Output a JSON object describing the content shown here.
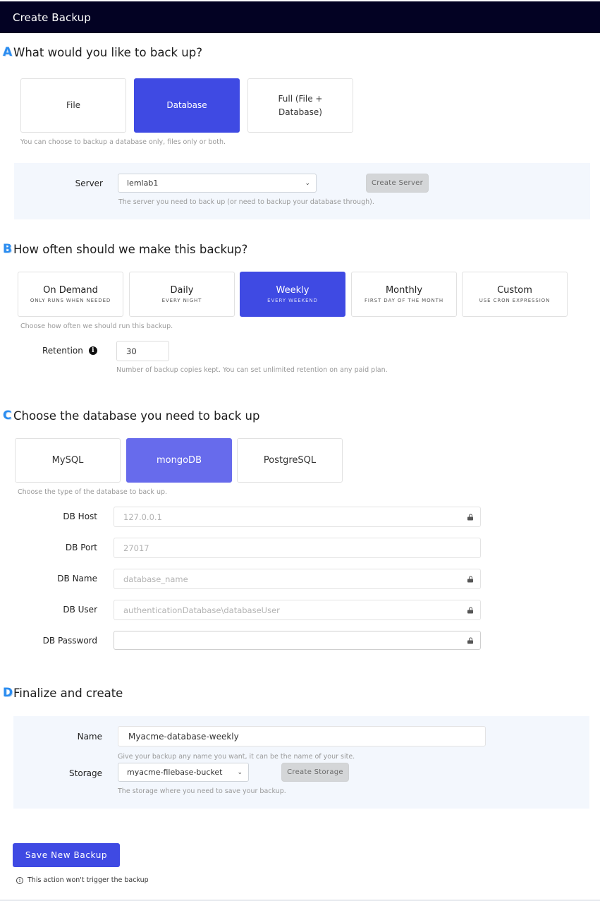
{
  "header": {
    "title": "Create Backup"
  },
  "section_a": {
    "badge": "A",
    "title": "What would you like to back up?",
    "options": [
      {
        "label": "File",
        "selected": false
      },
      {
        "label": "Database",
        "selected": true
      },
      {
        "label": "Full (File + Database)",
        "selected": false
      }
    ],
    "help": "You can choose to backup a database only, files only or both.",
    "server": {
      "label": "Server",
      "value": "lemlab1",
      "create_button": "Create Server",
      "help": "The server you need to back up (or need to backup your database through)."
    }
  },
  "section_b": {
    "badge": "B",
    "title": "How often should we make this backup?",
    "options": [
      {
        "label": "On Demand",
        "sub": "ONLY RUNS WHEN NEEDED",
        "selected": false
      },
      {
        "label": "Daily",
        "sub": "EVERY NIGHT",
        "selected": false
      },
      {
        "label": "Weekly",
        "sub": "EVERY WEEKEND",
        "selected": true
      },
      {
        "label": "Monthly",
        "sub": "FIRST DAY OF THE MONTH",
        "selected": false
      },
      {
        "label": "Custom",
        "sub": "USE CRON EXPRESSION",
        "selected": false
      }
    ],
    "help": "Choose how often we should run this backup.",
    "retention": {
      "label": "Retention",
      "info_icon": "i",
      "value": "30",
      "help": "Number of backup copies kept. You can set unlimited retention on any paid plan."
    }
  },
  "section_c": {
    "badge": "C",
    "title": "Choose the database you need to back up",
    "options": [
      {
        "label": "MySQL",
        "selected": false
      },
      {
        "label": "mongoDB",
        "selected": true
      },
      {
        "label": "PostgreSQL",
        "selected": false
      }
    ],
    "help": "Choose the type of the database to back up.",
    "fields": [
      {
        "label": "DB Host",
        "placeholder": "127.0.0.1",
        "locked": true
      },
      {
        "label": "DB Port",
        "placeholder": "27017",
        "locked": false
      },
      {
        "label": "DB Name",
        "placeholder": "database_name",
        "locked": true
      },
      {
        "label": "DB User",
        "placeholder": "authenticationDatabase\\databaseUser",
        "locked": true
      },
      {
        "label": "DB Password",
        "placeholder": "",
        "locked": true
      }
    ]
  },
  "section_d": {
    "badge": "D",
    "title": "Finalize and create",
    "name": {
      "label": "Name",
      "value": "Myacme-database-weekly",
      "help": "Give your backup any name you want, it can be the name of your site."
    },
    "storage": {
      "label": "Storage",
      "value": "myacme-filebase-bucket",
      "create_button": "Create Storage",
      "help": "The storage where you need to save your backup."
    }
  },
  "actions": {
    "save_label": "Save New Backup",
    "note_icon": "i",
    "note": "This action won't trigger the backup"
  },
  "colors": {
    "header_bg": "#030223",
    "accent": "#3f4ae3",
    "accent_soft": "#676bec",
    "panel_bg": "#f3f7fd",
    "badge": "#2a8cf0"
  }
}
